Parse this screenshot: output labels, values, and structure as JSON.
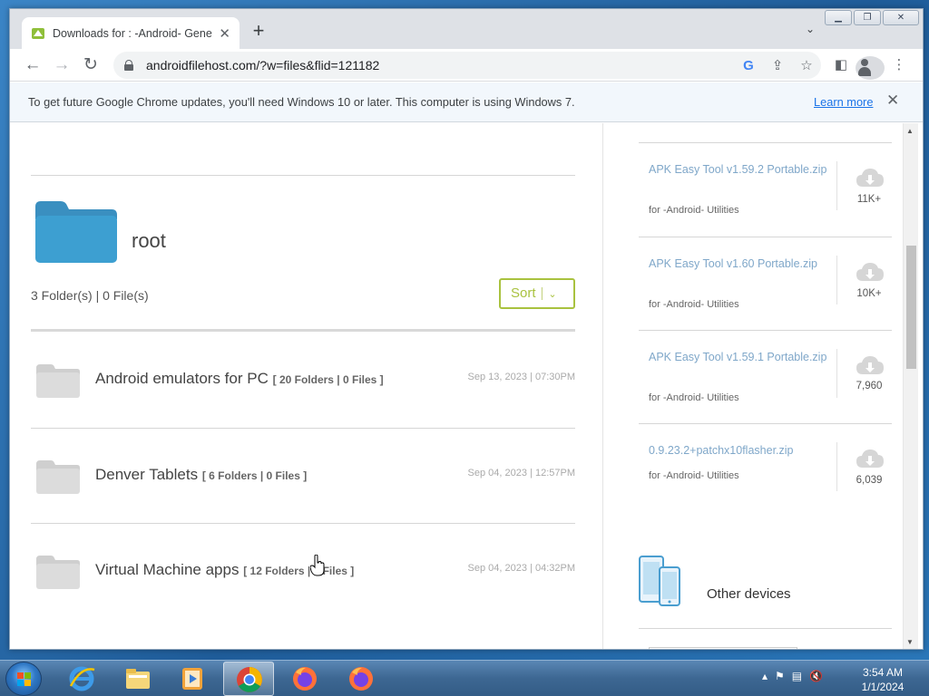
{
  "browser": {
    "tab_title": "Downloads for : -Android- Gene",
    "url": "androidfilehost.com/?w=files&flid=121182",
    "infobar": {
      "message": "To get future Google Chrome updates, you'll need Windows 10 or later. This computer is using Windows 7.",
      "learn_more": "Learn more"
    }
  },
  "page": {
    "root_title": "root",
    "counts": "3 Folder(s) | 0 File(s)",
    "sort_label": "Sort",
    "folders": [
      {
        "name": "Android emulators for PC",
        "meta": "[ 20 Folders | 0 Files ]",
        "date": "Sep 13, 2023 | 07:30PM"
      },
      {
        "name": "Denver Tablets",
        "meta": "[ 6 Folders | 0 Files ]",
        "date": "Sep 04, 2023 | 12:57PM"
      },
      {
        "name": "Virtual Machine apps",
        "meta": "[ 12 Folders | 0 Files ]",
        "date": "Sep 04, 2023 | 04:32PM"
      }
    ],
    "downloads": [
      {
        "name": "APK Easy Tool v1.59.2 Portable.zip",
        "category": "for -Android- Utilities",
        "count": "11K+"
      },
      {
        "name": "APK Easy Tool v1.60 Portable.zip",
        "category": "for -Android- Utilities",
        "count": "10K+"
      },
      {
        "name": "APK Easy Tool v1.59.1 Portable.zip",
        "category": "for -Android- Utilities",
        "count": "7,960"
      },
      {
        "name": "0.9.23.2+patchx10flasher.zip",
        "category": "for -Android- Utilities",
        "count": "6,039"
      }
    ],
    "other_devices": "Other devices"
  },
  "taskbar": {
    "time": "3:54 AM",
    "date": "1/1/2024"
  },
  "colors": {
    "accent_green": "#a9c23f",
    "link_blue": "#7fa7c9",
    "folder_blue": "#3d9fd1"
  },
  "icons": [
    "favicon-icon",
    "close-icon",
    "plus-icon",
    "chevron-down-icon",
    "back-icon",
    "forward-icon",
    "reload-icon",
    "lock-icon",
    "google-icon",
    "share-icon",
    "star-icon",
    "side-panel-icon",
    "profile-icon",
    "menu-icon",
    "folder-icon",
    "cloud-download-icon",
    "devices-icon",
    "windows-start-icon",
    "ie-icon",
    "explorer-icon",
    "media-player-icon",
    "chrome-icon",
    "firefox-icon"
  ]
}
